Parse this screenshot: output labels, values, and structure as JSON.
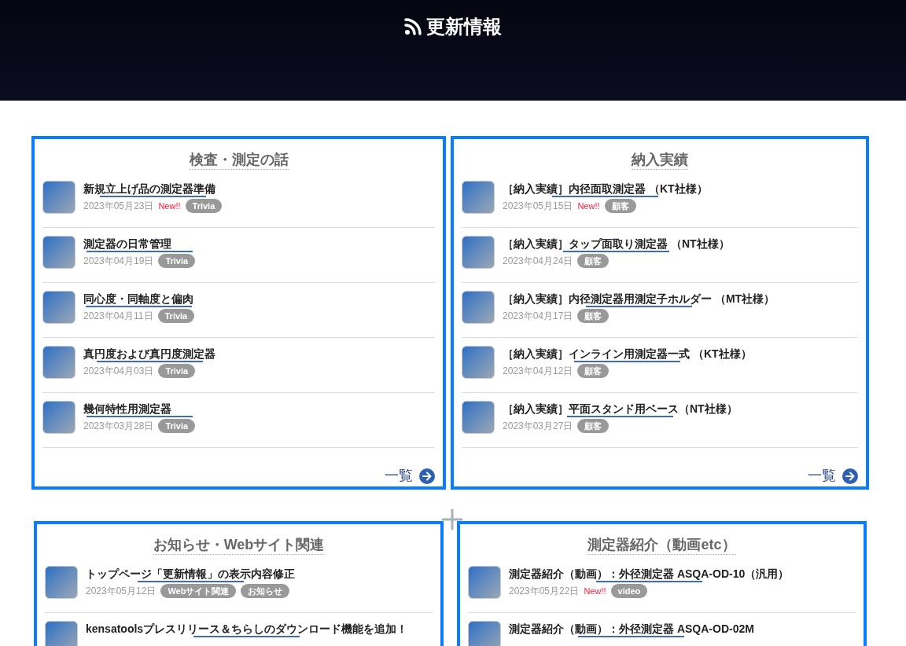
{
  "header": {
    "title": "更新情報"
  },
  "cards": [
    {
      "title": "検査・測定の話",
      "more": "一覧",
      "items": [
        {
          "title": "新規立上げ品の測定器準備",
          "date": "2023年05月23日",
          "badge": "New!!",
          "tags": [
            "Trivia"
          ]
        },
        {
          "title": "測定器の日常管理",
          "date": "2023年04月19日",
          "tags": [
            "Trivia"
          ]
        },
        {
          "title": "同心度・同軸度と偏肉",
          "date": "2023年04月11日",
          "tags": [
            "Trivia"
          ]
        },
        {
          "title": "真円度および真円度測定器",
          "date": "2023年04月03日",
          "tags": [
            "Trivia"
          ]
        },
        {
          "title": "幾何特性用測定器",
          "date": "2023年03月28日",
          "tags": [
            "Trivia"
          ]
        }
      ]
    },
    {
      "title": "納入実績",
      "more": "一覧",
      "items": [
        {
          "title": "［納入実績］内径面取測定器 （KT社様）",
          "date": "2023年05月15日",
          "badge": "New!!",
          "tags": [
            "顧客"
          ]
        },
        {
          "title": "［納入実績］タップ面取り測定器 （NT社様）",
          "date": "2023年04月24日",
          "tags": [
            "顧客"
          ]
        },
        {
          "title": "［納入実績］内径測定器用測定子ホルダー （MT社様）",
          "date": "2023年04月17日",
          "tags": [
            "顧客"
          ]
        },
        {
          "title": "［納入実績］インライン用測定器一式 （KT社様）",
          "date": "2023年04月12日",
          "tags": [
            "顧客"
          ]
        },
        {
          "title": "［納入実績］平面スタンド用ベース（NT社様）",
          "date": "2023年03月27日",
          "tags": [
            "顧客"
          ]
        }
      ]
    },
    {
      "title": "お知らせ・Webサイト関連",
      "items": [
        {
          "title": "トップページ「更新情報」の表示内容修正",
          "date": "2023年05月12日",
          "tags": [
            "Webサイト関連",
            "お知らせ"
          ]
        },
        {
          "title": "kensatoolsプレスリリース＆ちらしのダウンロード機能を追加！"
        }
      ]
    },
    {
      "title": "測定器紹介（動画etc）",
      "items": [
        {
          "title": "測定器紹介（動画）：外径測定器 ASQA-OD-10（汎用）",
          "date": "2023年05月22日",
          "badge": "New!!",
          "tags": [
            "video"
          ]
        },
        {
          "title": "測定器紹介（動画）：外径測定器 ASQA-OD-02M"
        }
      ]
    }
  ]
}
